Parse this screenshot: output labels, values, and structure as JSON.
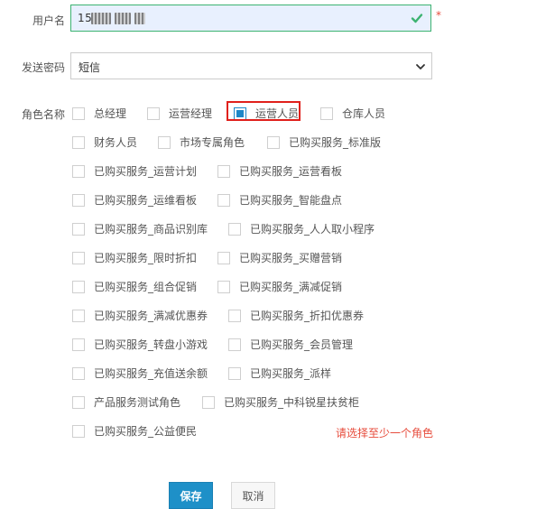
{
  "form": {
    "username_label": "用户名",
    "username_value": "15",
    "required_mark": "*",
    "method_label": "发送密码",
    "method_value": "短信",
    "roles_label": "角色名称",
    "error_text": "请选择至少一个角色",
    "save_label": "保存",
    "cancel_label": "取消"
  },
  "roles": [
    {
      "label": "总经理",
      "checked": false
    },
    {
      "label": "运营经理",
      "checked": false
    },
    {
      "label": "运营人员",
      "checked": true
    },
    {
      "label": "仓库人员",
      "checked": false
    },
    {
      "label": "财务人员",
      "checked": false
    },
    {
      "label": "市场专属角色",
      "checked": false
    },
    {
      "label": "已购买服务_标准版",
      "checked": false
    },
    {
      "label": "已购买服务_运营计划",
      "checked": false
    },
    {
      "label": "已购买服务_运营看板",
      "checked": false
    },
    {
      "label": "已购买服务_运维看板",
      "checked": false
    },
    {
      "label": "已购买服务_智能盘点",
      "checked": false
    },
    {
      "label": "已购买服务_商品识别库",
      "checked": false
    },
    {
      "label": "已购买服务_人人取小程序",
      "checked": false
    },
    {
      "label": "已购买服务_限时折扣",
      "checked": false
    },
    {
      "label": "已购买服务_买赠营销",
      "checked": false
    },
    {
      "label": "已购买服务_组合促销",
      "checked": false
    },
    {
      "label": "已购买服务_满减促销",
      "checked": false
    },
    {
      "label": "已购买服务_满减优惠券",
      "checked": false
    },
    {
      "label": "已购买服务_折扣优惠券",
      "checked": false
    },
    {
      "label": "已购买服务_转盘小游戏",
      "checked": false
    },
    {
      "label": "已购买服务_会员管理",
      "checked": false
    },
    {
      "label": "已购买服务_充值送余额",
      "checked": false
    },
    {
      "label": "已购买服务_派样",
      "checked": false
    },
    {
      "label": "产品服务测试角色",
      "checked": false
    },
    {
      "label": "已购买服务_中科锐星扶贫柜",
      "checked": false
    },
    {
      "label": "已购买服务_公益便民",
      "checked": false
    }
  ],
  "colors": {
    "accent": "#1e90c8",
    "error": "#e74c3c",
    "valid": "#3cb371",
    "highlight": "#e0201b"
  },
  "icons": {
    "valid": "check-icon",
    "dropdown": "chevron-down-icon"
  }
}
